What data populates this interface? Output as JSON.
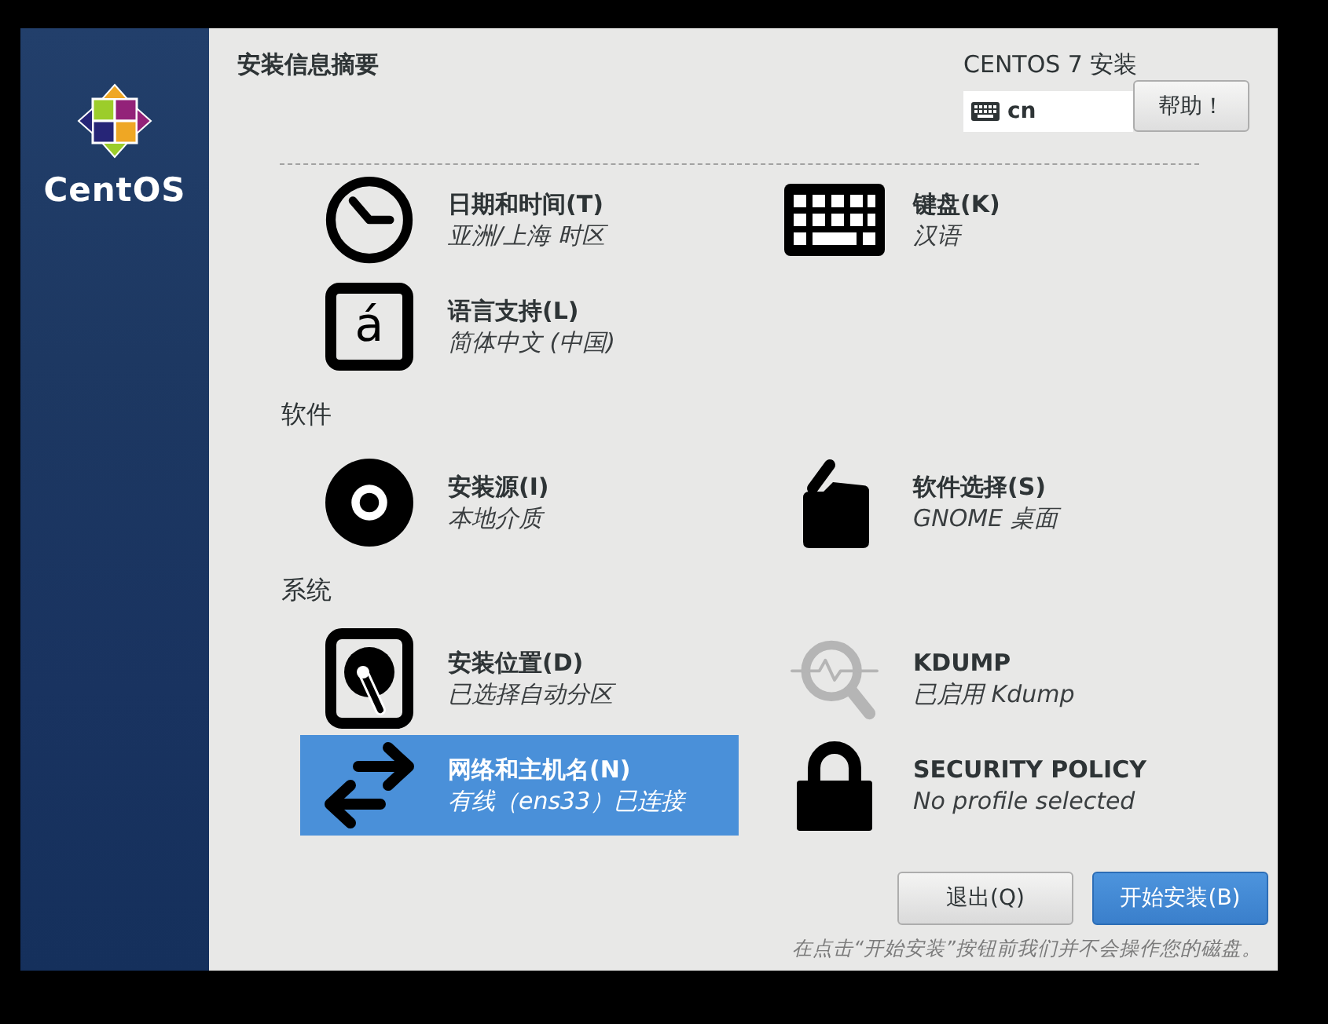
{
  "sidebar": {
    "logo_text": "CentOS"
  },
  "header": {
    "title": "安装信息摘要",
    "product": "CENTOS 7 安装",
    "layout_indicator": {
      "code": "cn"
    },
    "help_button": "帮助！"
  },
  "sections": [
    {
      "items": [
        {
          "kind": "clock",
          "title": "日期和时间(T)",
          "status": "亚洲/上海 时区",
          "selected": false
        },
        {
          "kind": "keyboard",
          "title": "键盘(K)",
          "status": "汉语",
          "selected": false
        },
        {
          "kind": "language",
          "glyph": "á",
          "title": "语言支持(L)",
          "status": "简体中文 (中国)",
          "selected": false
        }
      ]
    },
    {
      "heading": "软件",
      "items": [
        {
          "kind": "disc",
          "title": "安装源(I)",
          "status": "本地介质",
          "selected": false
        },
        {
          "kind": "package",
          "title": "软件选择(S)",
          "status": "GNOME 桌面",
          "selected": false
        }
      ]
    },
    {
      "heading": "系统",
      "items": [
        {
          "kind": "disk",
          "title": "安装位置(D)",
          "status": "已选择自动分区",
          "selected": false
        },
        {
          "kind": "kdump",
          "title": "KDUMP",
          "status": "已启用 Kdump",
          "selected": false
        },
        {
          "kind": "network",
          "title": "网络和主机名(N)",
          "status": "有线（ens33）已连接",
          "selected": true
        },
        {
          "kind": "lock",
          "title": "SECURITY POLICY",
          "status": "No profile selected",
          "selected": false
        }
      ]
    }
  ],
  "footer": {
    "buttons": [
      {
        "label": "退出(Q)",
        "kind": "secondary"
      },
      {
        "label": "开始安装(B)",
        "kind": "primary"
      }
    ],
    "note": "在点击“开始安装”按钮前我们并不会操作您的磁盘。"
  }
}
